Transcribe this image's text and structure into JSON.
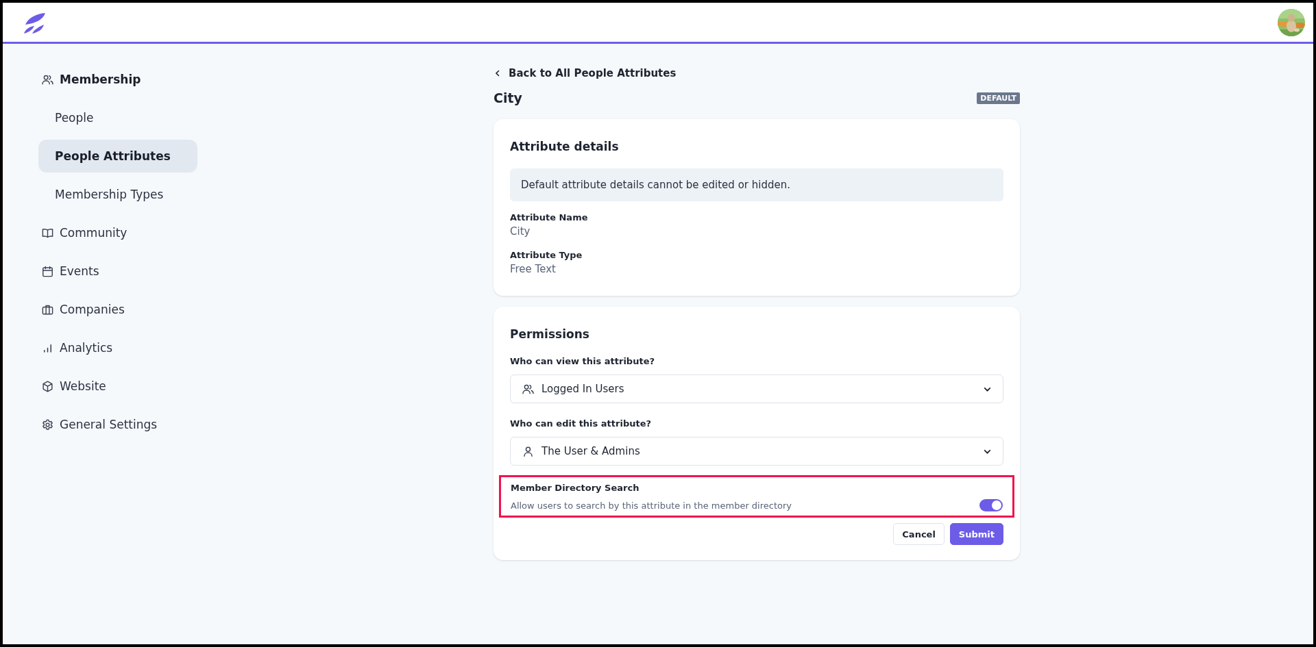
{
  "sidebar": {
    "items": [
      {
        "label": "Membership",
        "kind": "users",
        "expanded": true,
        "children": [
          {
            "label": "People",
            "selected": false
          },
          {
            "label": "People Attributes",
            "selected": true
          },
          {
            "label": "Membership Types",
            "selected": false
          }
        ]
      },
      {
        "label": "Community",
        "kind": "book",
        "expanded": false
      },
      {
        "label": "Events",
        "kind": "calendar",
        "expanded": false
      },
      {
        "label": "Companies",
        "kind": "briefcase",
        "expanded": false
      },
      {
        "label": "Analytics",
        "kind": "chart",
        "expanded": false
      },
      {
        "label": "Website",
        "kind": "cube",
        "expanded": false
      },
      {
        "label": "General Settings",
        "kind": "gear",
        "expanded": false
      }
    ]
  },
  "back_link": "Back to All People Attributes",
  "title": "City",
  "badge": "DEFAULT",
  "details_card": {
    "heading": "Attribute details",
    "notice": "Default attribute details cannot be edited or hidden.",
    "fields": [
      {
        "label": "Attribute Name",
        "value": "City"
      },
      {
        "label": "Attribute Type",
        "value": "Free Text"
      }
    ]
  },
  "permissions_card": {
    "heading": "Permissions",
    "selects": [
      {
        "label": "Who can view this attribute?",
        "value": "Logged In Users",
        "kind": "users"
      },
      {
        "label": "Who can edit this attribute?",
        "value": "The User & Admins",
        "kind": "user"
      }
    ],
    "toggle": {
      "label": "Member Directory Search",
      "description": "Allow users to search by this attribute in the member directory",
      "on": true,
      "highlighted": true
    },
    "buttons": [
      {
        "label": "Cancel",
        "kind": "secondary"
      },
      {
        "label": "Submit",
        "kind": "primary"
      }
    ]
  }
}
